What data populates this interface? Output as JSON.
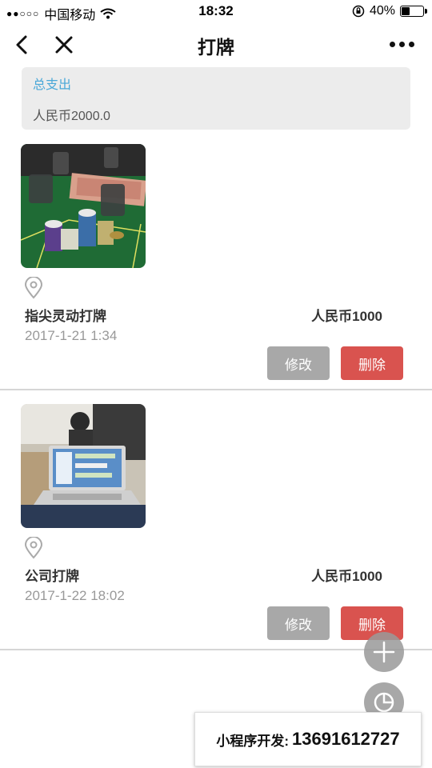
{
  "status": {
    "signal_dots": "●●○○○",
    "carrier": "中国移动",
    "time": "18:32",
    "battery_percent": "40%",
    "battery_level": 0.4
  },
  "nav": {
    "title": "打牌",
    "back_icon": "chevron-left-icon",
    "close_icon": "close-icon",
    "more_icon": "more-icon"
  },
  "summary": {
    "label": "总支出",
    "amount": "人民币2000.0"
  },
  "entries": [
    {
      "photo": "poker-table-photo",
      "location_icon": "location-pin-icon",
      "name": "指尖灵动打牌",
      "amount": "人民币1000",
      "date": "2017-1-21 1:34",
      "edit_label": "修改",
      "delete_label": "删除"
    },
    {
      "photo": "office-laptop-photo",
      "location_icon": "location-pin-icon",
      "name": "公司打牌",
      "amount": "人民币1000",
      "date": "2017-1-22 18:02",
      "edit_label": "修改",
      "delete_label": "删除"
    }
  ],
  "floating": {
    "add_icon": "plus-icon",
    "stats_icon": "pie-chart-icon"
  },
  "promo": {
    "label": "小程序开发:",
    "phone": "13691612727"
  },
  "colors": {
    "accent": "#4aa8d8",
    "delete": "#d9534f",
    "edit": "#a8a8a8"
  }
}
